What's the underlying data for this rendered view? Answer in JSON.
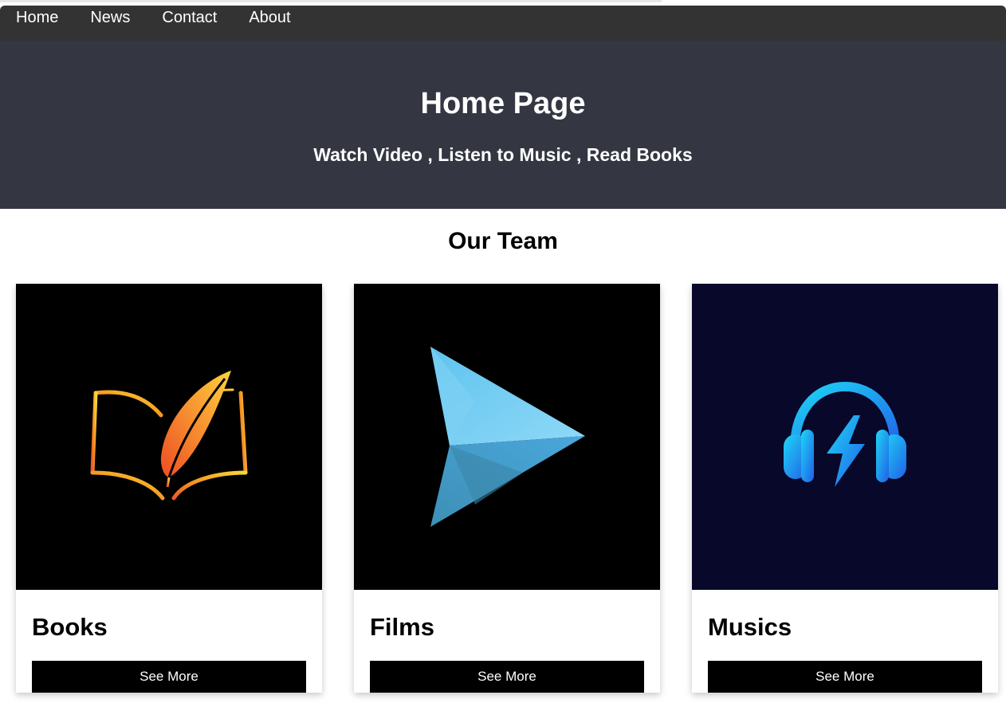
{
  "nav": {
    "items": [
      {
        "label": "Home"
      },
      {
        "label": "News"
      },
      {
        "label": "Contact"
      },
      {
        "label": "About"
      }
    ]
  },
  "hero": {
    "title": "Home Page",
    "subtitle": "Watch Video , Listen to Music , Read Books"
  },
  "team": {
    "title": "Our Team",
    "cards": [
      {
        "title": "Books",
        "button_label": "See More",
        "icon": "book-feather-icon",
        "image_bg": "#000000"
      },
      {
        "title": "Films",
        "button_label": "See More",
        "icon": "play-arrow-icon",
        "image_bg": "#000000"
      },
      {
        "title": "Musics",
        "button_label": "See More",
        "icon": "headphones-icon",
        "image_bg": "#08082a"
      }
    ]
  },
  "colors": {
    "navbar": "#333333",
    "hero": "#343741",
    "button": "#000000"
  }
}
